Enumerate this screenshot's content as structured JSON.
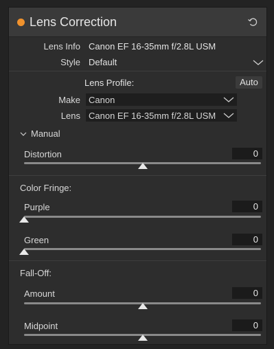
{
  "panel": {
    "title": "Lens Correction",
    "accent_color": "#f0922d",
    "reset_icon": "reset-arrow-icon"
  },
  "lens_info": {
    "label": "Lens Info",
    "value": "Canon EF 16-35mm f/2.8L USM"
  },
  "style": {
    "label": "Style",
    "value": "Default"
  },
  "lens_profile": {
    "label": "Lens Profile:",
    "auto_label": "Auto",
    "make_label": "Make",
    "make_value": "Canon",
    "lens_label": "Lens",
    "lens_value": "Canon EF 16-35mm f/2.8L USM"
  },
  "manual": {
    "label": "Manual",
    "distortion": {
      "label": "Distortion",
      "value": "0",
      "level": 0.5
    }
  },
  "color_fringe": {
    "label": "Color Fringe:",
    "purple": {
      "label": "Purple",
      "value": "0",
      "level": 0.0
    },
    "green": {
      "label": "Green",
      "value": "0",
      "level": 0.0
    }
  },
  "fall_off": {
    "label": "Fall-Off:",
    "amount": {
      "label": "Amount",
      "value": "0",
      "level": 0.5
    },
    "midpoint": {
      "label": "Midpoint",
      "value": "0",
      "level": 0.5
    }
  }
}
